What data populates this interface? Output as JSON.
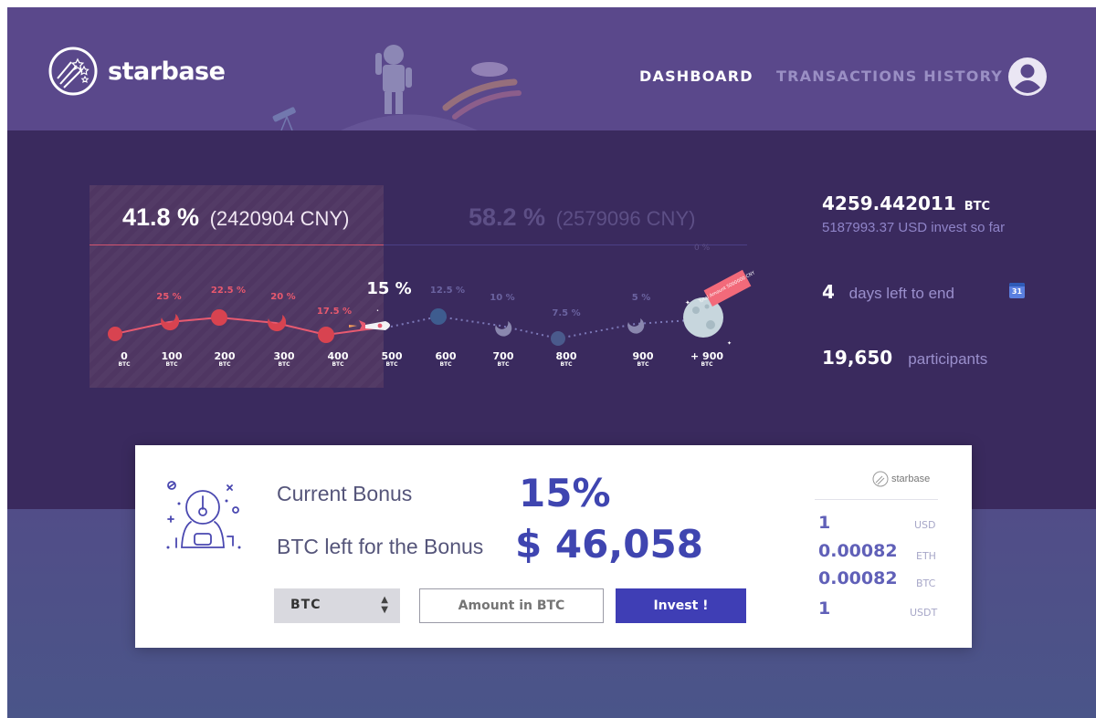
{
  "brand": {
    "name": "starbase"
  },
  "nav": [
    {
      "label": "DASHBOARD",
      "active": true
    },
    {
      "label": "TRANSACTIONS HISTORY",
      "active": false
    }
  ],
  "progress": {
    "raised_percent": "41.8 %",
    "raised_cny": "(2420904 CNY)",
    "remaining_percent": "58.2 %",
    "remaining_cny": "(2579096 CNY)",
    "end_percent": "0 %",
    "goal_tag": "Total Amount 5000000 CNY",
    "milestones": [
      {
        "btc": "0",
        "unit": "BTC",
        "bonus": "",
        "state": "done"
      },
      {
        "btc": "100",
        "unit": "BTC",
        "bonus": "25 %",
        "state": "done"
      },
      {
        "btc": "200",
        "unit": "BTC",
        "bonus": "22.5 %",
        "state": "done"
      },
      {
        "btc": "300",
        "unit": "BTC",
        "bonus": "20 %",
        "state": "done"
      },
      {
        "btc": "400",
        "unit": "BTC",
        "bonus": "17.5 %",
        "state": "done"
      },
      {
        "btc": "500",
        "unit": "BTC",
        "bonus": "15 %",
        "state": "current"
      },
      {
        "btc": "600",
        "unit": "BTC",
        "bonus": "12.5 %",
        "state": "todo"
      },
      {
        "btc": "700",
        "unit": "BTC",
        "bonus": "10 %",
        "state": "todo"
      },
      {
        "btc": "800",
        "unit": "BTC",
        "bonus": "7.5 %",
        "state": "todo"
      },
      {
        "btc": "900",
        "unit": "BTC",
        "bonus": "5 %",
        "state": "todo"
      },
      {
        "btc": "+ 900",
        "unit": "BTC",
        "bonus": "",
        "state": "todo"
      }
    ]
  },
  "stats": {
    "btc_total": "4259.442011",
    "btc_unit": "BTC",
    "usd_invested": "5187993.37 USD invest so far",
    "days_left": "4",
    "days_label": "days left to end",
    "calendar_day": "31",
    "participants": "19,650",
    "participants_label": "participants"
  },
  "panel": {
    "current_bonus_label": "Current Bonus",
    "current_bonus_value": "15%",
    "btc_left_label": "BTC left for the Bonus",
    "btc_left_value": "$ 46,058",
    "currency_select": "BTC",
    "amount_placeholder": "Amount in BTC",
    "invest_label": "Invest !",
    "mini_brand": "starbase",
    "rates": [
      {
        "value": "1",
        "unit": "USD"
      },
      {
        "value": "0.00082",
        "unit": "ETH"
      },
      {
        "value": "0.00082",
        "unit": "BTC"
      },
      {
        "value": "1",
        "unit": "USDT"
      }
    ]
  },
  "colors": {
    "header_bg": "#5a488b",
    "hero_bg": "#3a2a5e",
    "progress_done": "#e8596e",
    "accent_blue": "#3f45b0",
    "invest_button": "#3f3eb5"
  },
  "icons": [
    "starbase-logo-icon",
    "astronaut-icon",
    "telescope-icon",
    "shooting-stars-icon",
    "user-avatar-icon",
    "rocket-icon",
    "moon-icon",
    "calendar-icon",
    "select-arrows-icon"
  ]
}
